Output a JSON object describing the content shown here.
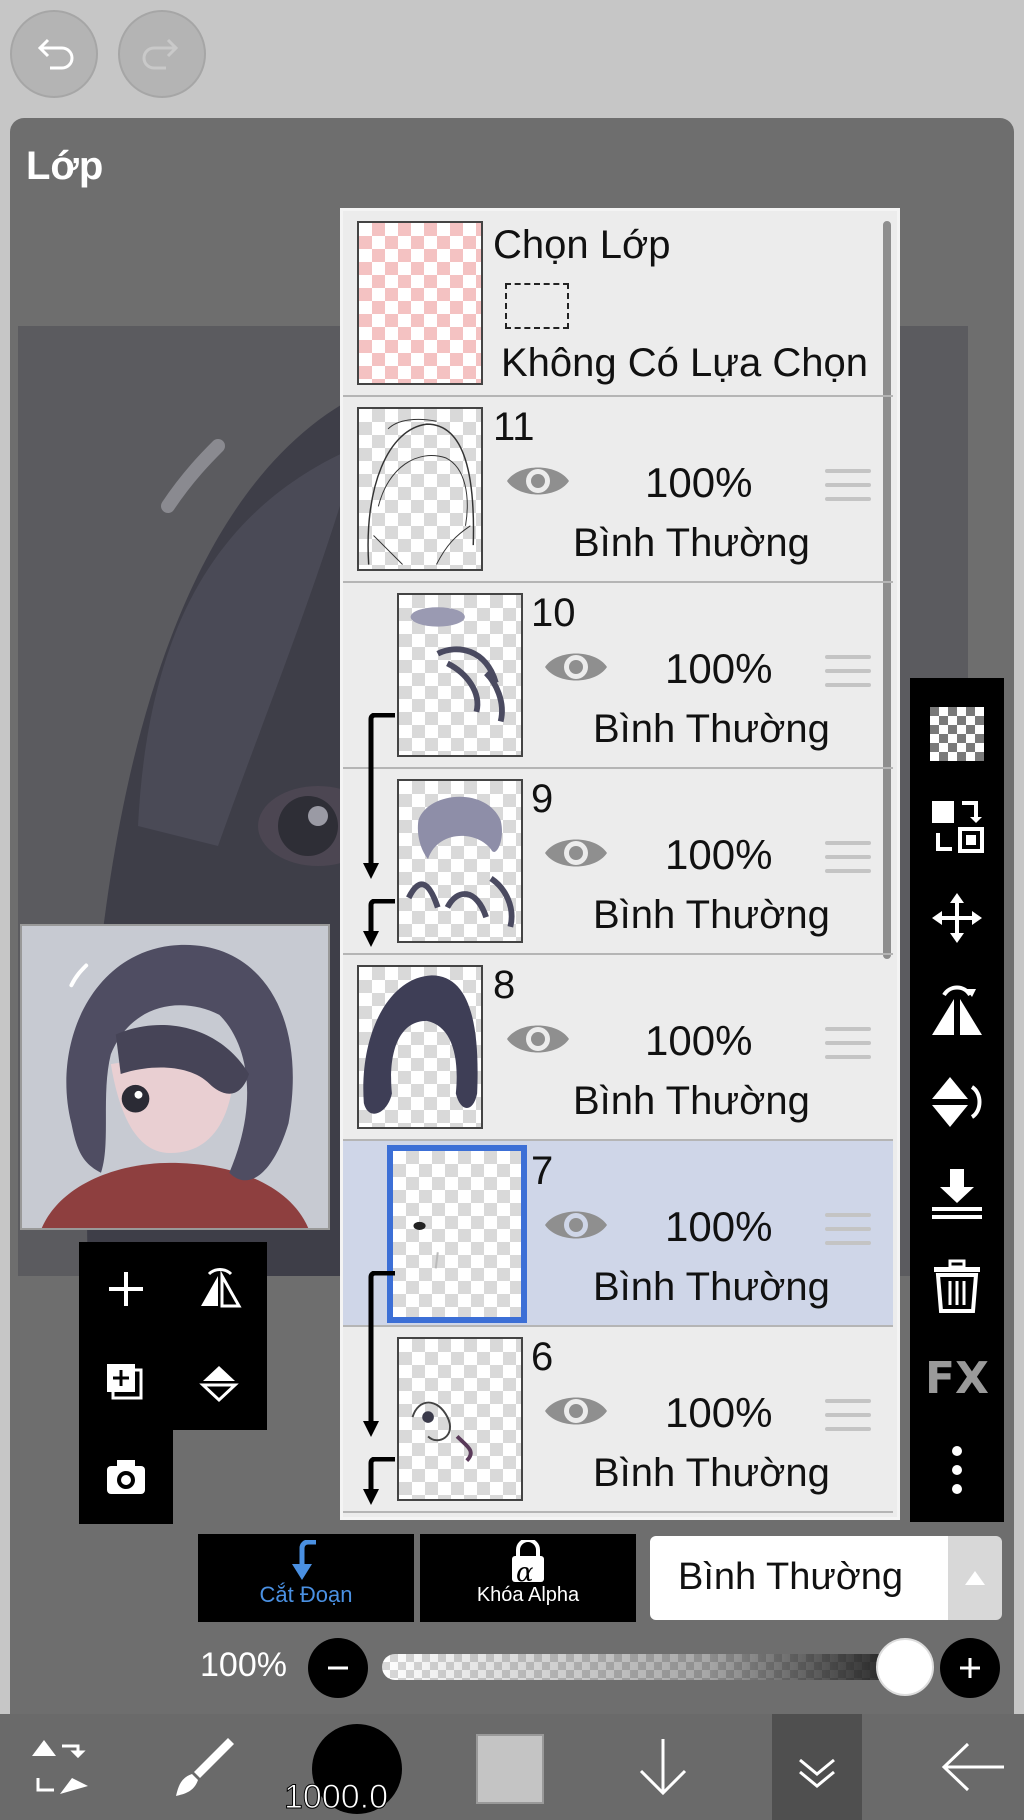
{
  "panel": {
    "title": "Lớp"
  },
  "selection_layer": {
    "title": "Chọn Lớp",
    "status": "Không Có Lựa Chọn"
  },
  "layers": [
    {
      "name": "11",
      "opacity": "100%",
      "blend": "Bình Thường",
      "clipped": false,
      "selected": false
    },
    {
      "name": "10",
      "opacity": "100%",
      "blend": "Bình Thường",
      "clipped": true,
      "selected": false
    },
    {
      "name": "9",
      "opacity": "100%",
      "blend": "Bình Thường",
      "clipped": true,
      "selected": false
    },
    {
      "name": "8",
      "opacity": "100%",
      "blend": "Bình Thường",
      "clipped": false,
      "selected": false
    },
    {
      "name": "7",
      "opacity": "100%",
      "blend": "Bình Thường",
      "clipped": true,
      "selected": true
    },
    {
      "name": "6",
      "opacity": "100%",
      "blend": "Bình Thường",
      "clipped": true,
      "selected": false
    }
  ],
  "options": {
    "clip_label": "Cắt Đoạn",
    "alpha_lock_label": "Khóa Alpha",
    "alpha_symbol": "α",
    "blend_mode": "Bình Thường"
  },
  "opacity": {
    "label": "100%",
    "value": 1.0
  },
  "bottom": {
    "brush_size": "1000.0"
  },
  "right_tools": [
    "transparent-icon",
    "layer-swap-icon",
    "move-icon",
    "flip-horizontal-icon",
    "flip-vertical-icon",
    "merge-down-icon",
    "trash-icon",
    "fx-icon",
    "more-icon"
  ],
  "fx_label": "FX",
  "colors": {
    "accent": "#3c6fd6",
    "clip_blue": "#4a90e2",
    "selected_row": "#cfd6e8"
  }
}
